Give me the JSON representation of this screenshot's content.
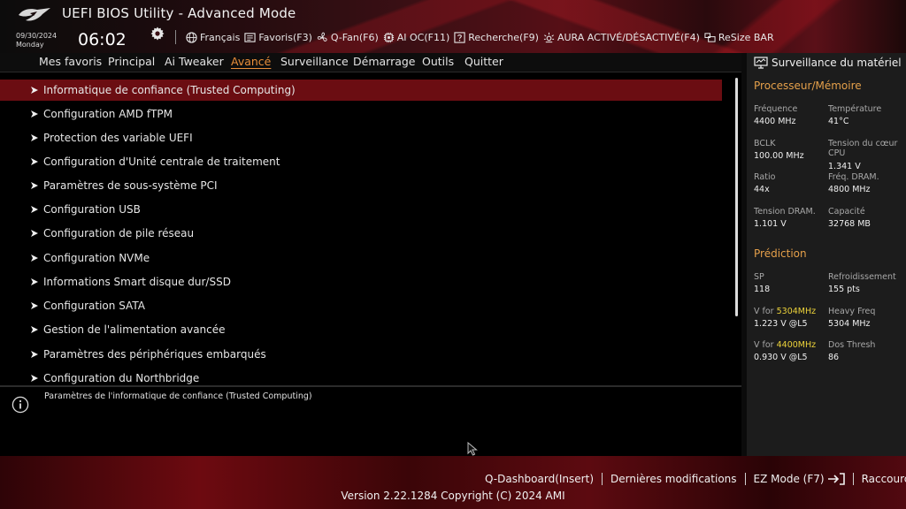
{
  "header": {
    "title": "UEFI BIOS Utility - Advanced Mode",
    "date": "09/30/2024",
    "day": "Monday",
    "time": "06:02",
    "toolbar": [
      {
        "label": "Français",
        "icon": "globe-icon"
      },
      {
        "label": "Favoris(F3)",
        "icon": "favorites-icon"
      },
      {
        "label": "Q-Fan(F6)",
        "icon": "fan-icon"
      },
      {
        "label": "AI OC(F11)",
        "icon": "chip-icon"
      },
      {
        "label": "Recherche(F9)",
        "icon": "search-help-icon"
      },
      {
        "label": "AURA ACTIVÉ/DÉSACTIVÉ(F4)",
        "icon": "aura-icon"
      },
      {
        "label": "ReSize BAR",
        "icon": "resize-bar-icon"
      }
    ]
  },
  "nav": {
    "tabs": [
      {
        "label": "Mes favoris"
      },
      {
        "label": "Principal"
      },
      {
        "label": "Ai Tweaker"
      },
      {
        "label": "Avancé",
        "active": true
      },
      {
        "label": "Surveillance"
      },
      {
        "label": "Démarrage"
      },
      {
        "label": "Outils"
      },
      {
        "label": "Quitter"
      }
    ]
  },
  "menu": {
    "items": [
      {
        "label": "Informatique de confiance (Trusted Computing)",
        "selected": true
      },
      {
        "label": "Configuration AMD fTPM"
      },
      {
        "label": "Protection des variable UEFI"
      },
      {
        "label": "Configuration d'Unité centrale de traitement"
      },
      {
        "label": "Paramètres de sous-système PCI"
      },
      {
        "label": "Configuration USB"
      },
      {
        "label": "Configuration de pile réseau"
      },
      {
        "label": "Configuration NVMe"
      },
      {
        "label": "Informations Smart disque dur/SSD"
      },
      {
        "label": "Configuration SATA"
      },
      {
        "label": "Gestion de l'alimentation avancée"
      },
      {
        "label": "Paramètres des périphériques embarqués"
      },
      {
        "label": "Configuration du Northbridge"
      }
    ]
  },
  "help": {
    "text": "Paramètres de l'informatique de confiance (Trusted Computing)"
  },
  "monitor": {
    "title": "Surveillance du matériel",
    "cpu_mem": {
      "title": "Processeur/Mémoire",
      "freq_label": "Fréquence",
      "freq_value": "4400 MHz",
      "temp_label": "Température",
      "temp_value": "41°C",
      "bclk_label": "BCLK",
      "bclk_value": "100.00 MHz",
      "vcore_label": "Tension du cœur CPU",
      "vcore_value": "1.341 V",
      "ratio_label": "Ratio",
      "ratio_value": "44x",
      "dram_freq_label": "Fréq. DRAM.",
      "dram_freq_value": "4800 MHz",
      "dram_volt_label": "Tension DRAM.",
      "dram_volt_value": "1.101 V",
      "capacity_label": "Capacité",
      "capacity_value": "32768 MB"
    },
    "prediction": {
      "title": "Prédiction",
      "sp_label": "SP",
      "sp_value": "118",
      "cooling_label": "Refroidissement",
      "cooling_value": "155 pts",
      "v1_prefix": "V for ",
      "v1_freq": "5304MHz",
      "v1_value": "1.223 V @L5",
      "heavy_label": "Heavy Freq",
      "heavy_value": "5304 MHz",
      "v2_prefix": "V for ",
      "v2_freq": "4400MHz",
      "v2_value": "0.930 V @L5",
      "dos_label": "Dos Thresh",
      "dos_value": "86"
    }
  },
  "footer": {
    "qdash": "Q-Dashboard(Insert)",
    "recent": "Dernières modifications",
    "ez": "EZ Mode (F7)",
    "shortcuts": "Raccourcis",
    "copyright": "Version 2.22.1284 Copyright (C) 2024 AMI"
  },
  "colors": {
    "accent": "#e98e3a",
    "highlight": "#ecd23a",
    "selection": "#6b0d12"
  }
}
